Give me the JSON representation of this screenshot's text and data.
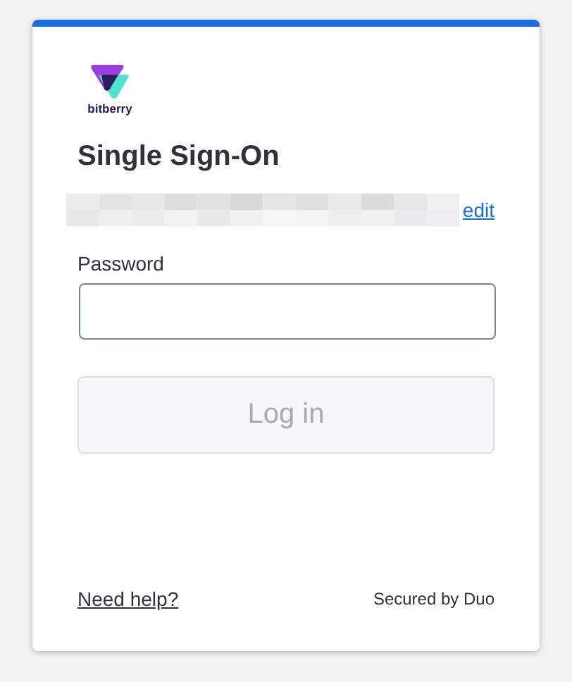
{
  "logo": {
    "wordmark": "bitberry"
  },
  "title": "Single Sign-On",
  "identity": {
    "action": "edit"
  },
  "password": {
    "label": "Password"
  },
  "login_button": {
    "label": "Log in",
    "disabled": true
  },
  "footer": {
    "help_link": "Need help?",
    "secured_by": "Secured by Duo"
  }
}
